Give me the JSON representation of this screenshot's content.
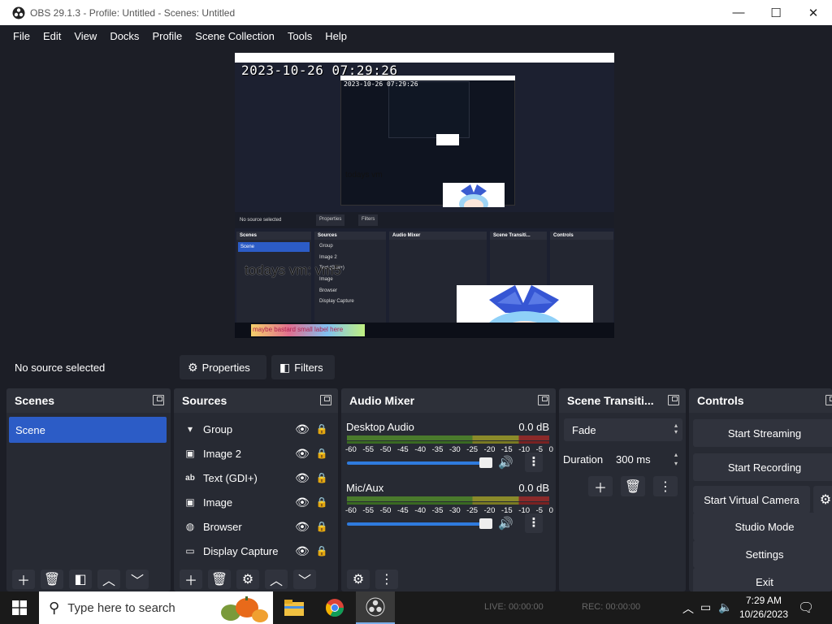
{
  "window": {
    "title": "OBS 29.1.3 - Profile: Untitled - Scenes: Untitled",
    "minimize": "—",
    "maximize": "☐",
    "close": "✕"
  },
  "menu": [
    "File",
    "Edit",
    "View",
    "Docks",
    "Profile",
    "Scene Collection",
    "Tools",
    "Help"
  ],
  "preview": {
    "timestamp": "2023-10-26 07:29:26",
    "timestamp_small": "2023-10-26 07:29:26",
    "overlay_text": "todays vm: vm5",
    "overlay_text_small": "todays vm",
    "nested_no_source": "No source selected",
    "nested_properties": "Properties",
    "nested_filters": "Filters",
    "nested_scenes": "Scenes",
    "nested_sources": "Sources",
    "nested_audio": "Audio Mixer",
    "nested_trans": "Scene Transiti...",
    "nested_controls": "Controls",
    "nested_scene": "Scene",
    "nested_sources_list": [
      "Group",
      "Image 2",
      "Text (GDI+)",
      "Image",
      "Browser",
      "Display Capture"
    ],
    "nested_search": "maybe bastard small label here"
  },
  "source_toolbar": {
    "no_source": "No source selected",
    "properties": "Properties",
    "filters": "Filters"
  },
  "scenes": {
    "title": "Scenes",
    "items": [
      "Scene"
    ]
  },
  "sources": {
    "title": "Sources",
    "items": [
      {
        "label": "Group",
        "icon": "chevron-folder-icon"
      },
      {
        "label": "Image 2",
        "icon": "image-icon"
      },
      {
        "label": "Text (GDI+)",
        "icon": "text-icon"
      },
      {
        "label": "Image",
        "icon": "image-icon"
      },
      {
        "label": "Browser",
        "icon": "globe-icon"
      },
      {
        "label": "Display Capture",
        "icon": "monitor-icon"
      }
    ]
  },
  "audio_mixer": {
    "title": "Audio Mixer",
    "scale": [
      "-60",
      "-55",
      "-50",
      "-45",
      "-40",
      "-35",
      "-30",
      "-25",
      "-20",
      "-15",
      "-10",
      "-5",
      "0"
    ],
    "channels": [
      {
        "name": "Desktop Audio",
        "db": "0.0 dB",
        "volume": 1.0
      },
      {
        "name": "Mic/Aux",
        "db": "0.0 dB",
        "volume": 1.0
      }
    ]
  },
  "transitions": {
    "title": "Scene Transiti...",
    "selected": "Fade",
    "duration_label": "Duration",
    "duration_value": "300 ms"
  },
  "controls": {
    "title": "Controls",
    "start_streaming": "Start Streaming",
    "start_recording": "Start Recording",
    "start_virtual_camera": "Start Virtual Camera",
    "studio_mode": "Studio Mode",
    "settings": "Settings",
    "exit": "Exit"
  },
  "status": {
    "live": "LIVE: 00:00:00",
    "rec": "REC: 00:00:00"
  },
  "taskbar": {
    "search_placeholder": "Type here to search",
    "time": "7:29 AM",
    "date": "10/26/2023"
  },
  "colors": {
    "accent": "#2c5cc6",
    "bg": "#1c1e26",
    "panel": "#272a33"
  }
}
